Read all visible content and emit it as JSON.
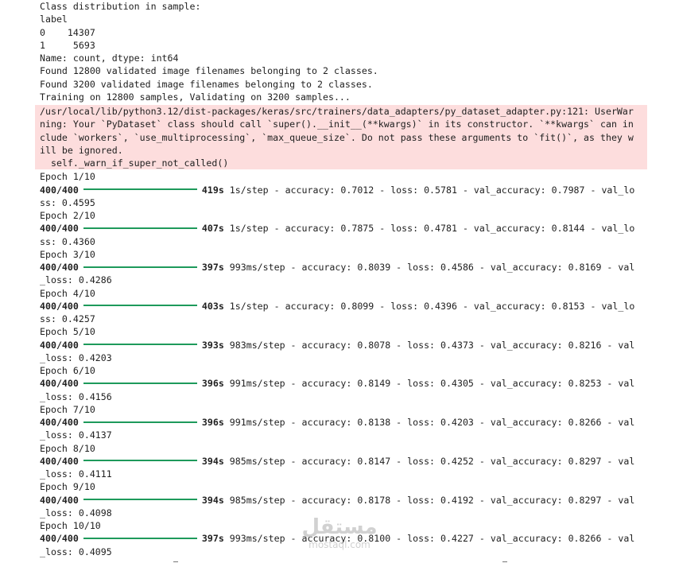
{
  "output": {
    "header_lines": [
      "Class distribution in sample:",
      "label",
      "0    14307",
      "1     5693",
      "Name: count, dtype: int64",
      "Found 12800 validated image filenames belonging to 2 classes.",
      "Found 3200 validated image filenames belonging to 2 classes.",
      "Training on 12800 samples, Validating on 3200 samples..."
    ],
    "warning_lines": [
      "/usr/local/lib/python3.12/dist-packages/keras/src/trainers/data_adapters/py_dataset_adapter.py:121: UserWar",
      "ning: Your `PyDataset` class should call `super().__init__(**kwargs)` in its constructor. `**kwargs` can in",
      "clude `workers`, `use_multiprocessing`, `max_queue_size`. Do not pass these arguments to `fit()`, as they w",
      "ill be ignored.",
      "  self._warn_if_super_not_called()"
    ],
    "epochs": [
      {
        "epoch": "Epoch 1/10",
        "steps": "400/400",
        "time": "419s",
        "rest": "1s/step - accuracy: 0.7012 - loss: 0.5781 - val_accuracy: 0.7987 - val_lo",
        "wrap": "ss: 0.4595",
        "progress": 1.0
      },
      {
        "epoch": "Epoch 2/10",
        "steps": "400/400",
        "time": "407s",
        "rest": "1s/step - accuracy: 0.7875 - loss: 0.4781 - val_accuracy: 0.8144 - val_lo",
        "wrap": "ss: 0.4360",
        "progress": 1.0
      },
      {
        "epoch": "Epoch 3/10",
        "steps": "400/400",
        "time": "397s",
        "rest": "993ms/step - accuracy: 0.8039 - loss: 0.4586 - val_accuracy: 0.8169 - val",
        "wrap": "_loss: 0.4286",
        "progress": 1.0
      },
      {
        "epoch": "Epoch 4/10",
        "steps": "400/400",
        "time": "403s",
        "rest": "1s/step - accuracy: 0.8099 - loss: 0.4396 - val_accuracy: 0.8153 - val_lo",
        "wrap": "ss: 0.4257",
        "progress": 1.0
      },
      {
        "epoch": "Epoch 5/10",
        "steps": "400/400",
        "time": "393s",
        "rest": "983ms/step - accuracy: 0.8078 - loss: 0.4373 - val_accuracy: 0.8216 - val",
        "wrap": "_loss: 0.4203",
        "progress": 1.0
      },
      {
        "epoch": "Epoch 6/10",
        "steps": "400/400",
        "time": "396s",
        "rest": "991ms/step - accuracy: 0.8149 - loss: 0.4305 - val_accuracy: 0.8253 - val",
        "wrap": "_loss: 0.4156",
        "progress": 1.0
      },
      {
        "epoch": "Epoch 7/10",
        "steps": "400/400",
        "time": "396s",
        "rest": "991ms/step - accuracy: 0.8138 - loss: 0.4203 - val_accuracy: 0.8266 - val",
        "wrap": "_loss: 0.4137",
        "progress": 1.0
      },
      {
        "epoch": "Epoch 8/10",
        "steps": "400/400",
        "time": "394s",
        "rest": "985ms/step - accuracy: 0.8147 - loss: 0.4252 - val_accuracy: 0.8297 - val",
        "wrap": "_loss: 0.4111",
        "progress": 1.0
      },
      {
        "epoch": "Epoch 9/10",
        "steps": "400/400",
        "time": "394s",
        "rest": "985ms/step - accuracy: 0.8178 - loss: 0.4192 - val_accuracy: 0.8297 - val",
        "wrap": "_loss: 0.4098",
        "progress": 1.0
      },
      {
        "epoch": "Epoch 10/10",
        "steps": "400/400",
        "time": "397s",
        "rest": "993ms/step - accuracy: 0.8100 - loss: 0.4227 - val_accuracy: 0.8266 - val",
        "wrap": "_loss: 0.4095",
        "progress": 1.0
      }
    ]
  },
  "watermark": {
    "glyph": "مستقل",
    "text": "mostaql.com"
  },
  "colors": {
    "progress_bar": "#1e9a5b",
    "warning_background": "#fddddd"
  }
}
